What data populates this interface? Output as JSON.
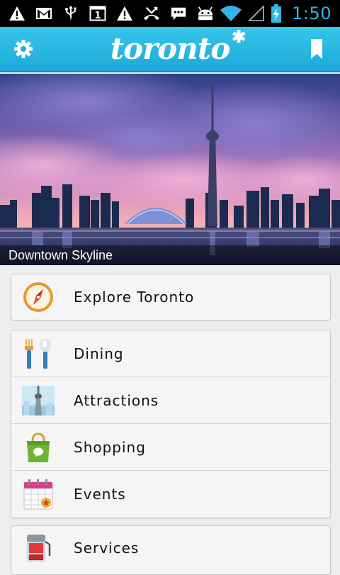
{
  "status_bar": {
    "notification_icons": [
      "warning-icon",
      "gmail-icon",
      "usb-icon",
      "calendar-icon",
      "warning-icon",
      "missed-call-icon",
      "chat-icon",
      "android-icon"
    ],
    "calendar_day": "1",
    "time": "1:50"
  },
  "app_bar": {
    "logo_text": "toronto",
    "logo_mark": "✱"
  },
  "hero": {
    "caption": "Downtown Skyline"
  },
  "menu": {
    "explore": {
      "label": "Explore Toronto",
      "icon": "compass-icon"
    },
    "categories": [
      {
        "label": "Dining",
        "icon": "fork-spoon-icon"
      },
      {
        "label": "Attractions",
        "icon": "cn-tower-icon"
      },
      {
        "label": "Shopping",
        "icon": "shopping-bag-icon"
      },
      {
        "label": "Events",
        "icon": "calendar-icon"
      }
    ],
    "services": {
      "label": "Services",
      "icon": "gas-pump-icon"
    }
  },
  "colors": {
    "app_bar": "#29b6e4",
    "clock": "#33b5e5",
    "card_bg": "#f5f5f5"
  }
}
